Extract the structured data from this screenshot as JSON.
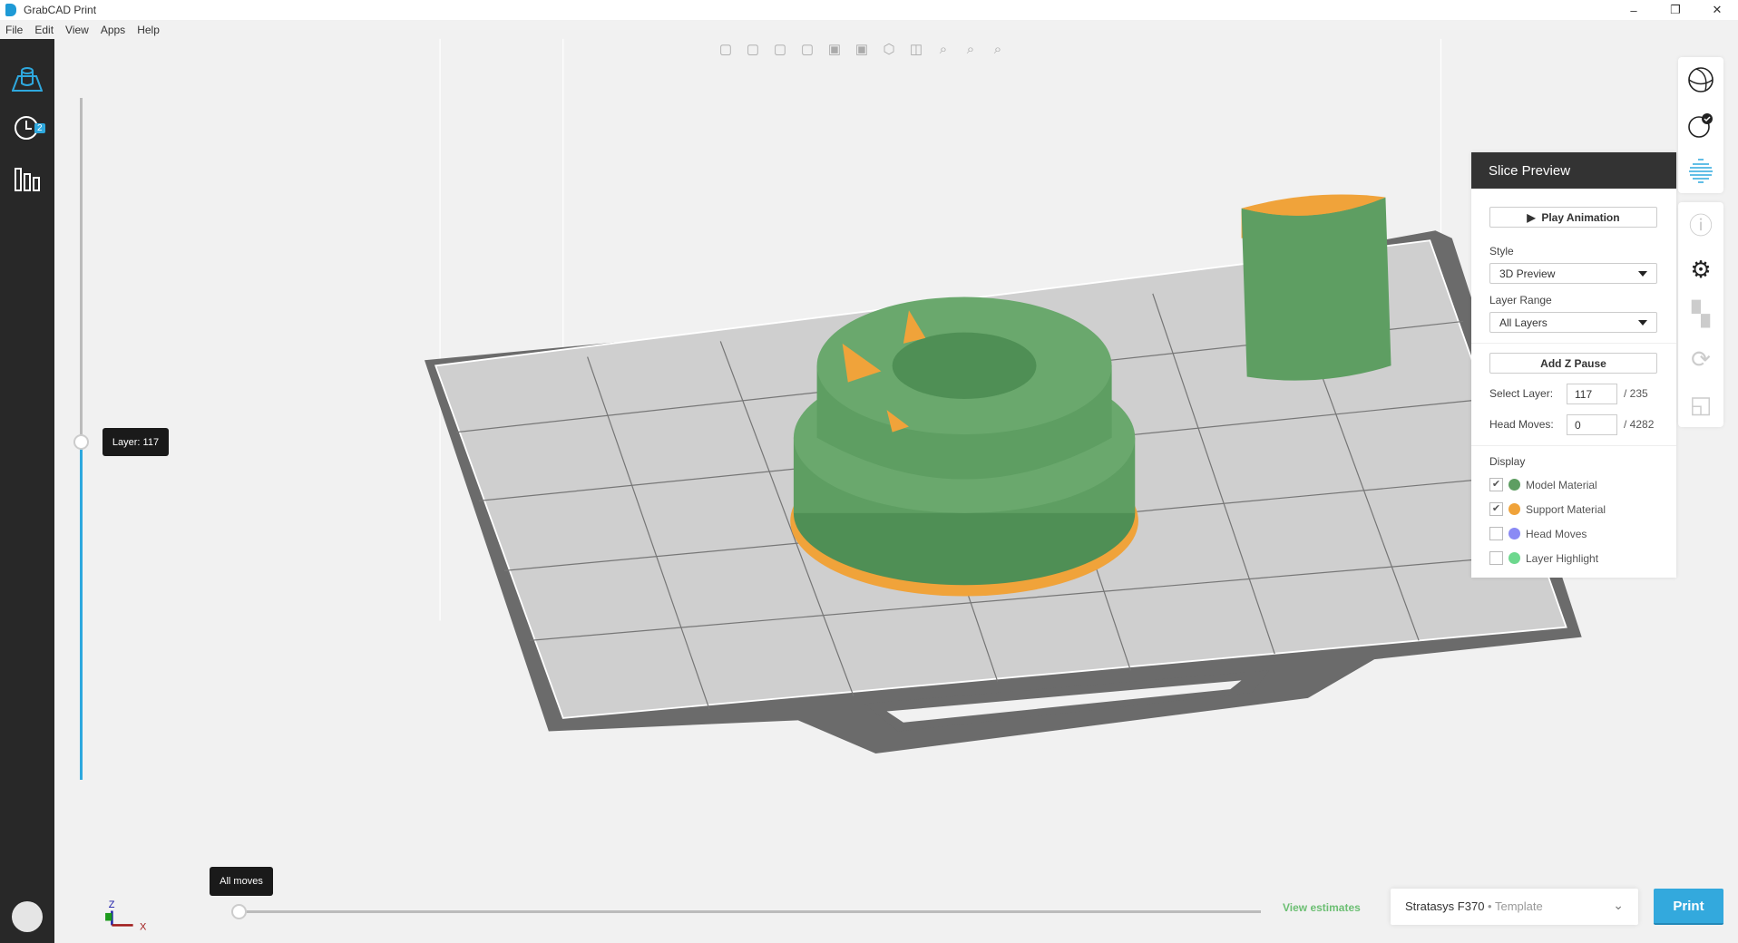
{
  "app": {
    "title": "GrabCAD Print",
    "menu": [
      "File",
      "Edit",
      "View",
      "Apps",
      "Help"
    ]
  },
  "sidebar": {
    "items": [
      {
        "icon": "tray-icon",
        "active": true
      },
      {
        "icon": "clock-icon",
        "badge": "2"
      },
      {
        "icon": "bars-icon"
      }
    ]
  },
  "layer_slider": {
    "label": "Layer: 117",
    "value": 117,
    "max": 235
  },
  "moves_slider": {
    "label": "All moves",
    "value": 0
  },
  "toolbar": {
    "icons": [
      "view-front-icon",
      "view-back-icon",
      "view-left-icon",
      "view-right-icon",
      "view-top-icon",
      "view-bottom-icon",
      "view-iso-icon",
      "view-perspective-icon",
      "zoom-all-icon",
      "zoom-selected-icon",
      "zoom-tray-icon"
    ]
  },
  "slice_preview": {
    "title": "Slice Preview",
    "play": "Play Animation",
    "style_label": "Style",
    "style_value": "3D Preview",
    "range_label": "Layer Range",
    "range_value": "All Layers",
    "zpause": "Add Z Pause",
    "select_layer_label": "Select Layer:",
    "select_layer": "117",
    "layer_total": "/ 235",
    "head_moves_label": "Head Moves:",
    "head_moves": "0",
    "moves_total": "/ 4282",
    "display_label": "Display",
    "display": [
      {
        "label": "Model Material",
        "checked": true,
        "color": "#5e9e62"
      },
      {
        "label": "Support Material",
        "checked": true,
        "color": "#f0a33a"
      },
      {
        "label": "Head Moves",
        "checked": false,
        "color": "#8a8af5"
      },
      {
        "label": "Layer Highlight",
        "checked": false,
        "color": "#6dd88e"
      }
    ]
  },
  "footer": {
    "estimates": "View estimates",
    "printer": "Stratasys F370",
    "printer_sep": " • ",
    "printer_template": "Template",
    "print": "Print"
  },
  "axes": {
    "z": "Z",
    "x": "X"
  },
  "colors": {
    "accent": "#2ea8de",
    "model": "#5e9e62",
    "support": "#f0a33a"
  }
}
